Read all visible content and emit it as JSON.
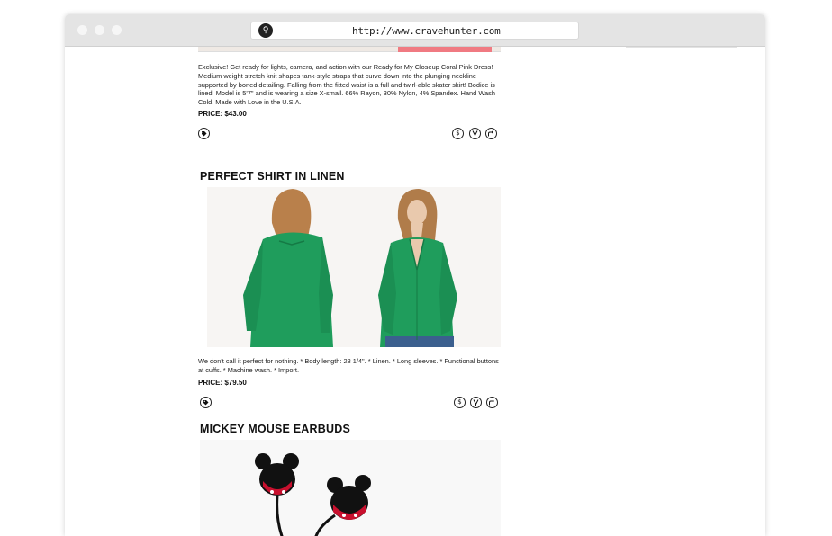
{
  "browser": {
    "url": "http://www.cravehunter.com",
    "logo_glyph": "⚲"
  },
  "products": [
    {
      "description": "Exclusive! Get ready for lights, camera, and action with our Ready for My Closeup Coral Pink Dress! Medium weight stretch knit shapes tank-style straps that curve down into the plunging neckline supported by boned detailing. Falling from the fitted waist is a full and twirl-able skater skirt! Bodice is lined. Model is 5'7\" and is wearing a size X-small. 66% Rayon, 30% Nylon, 4% Spandex. Hand Wash Cold. Made with Love in the U.S.A.",
      "price": "PRICE: $43.00"
    },
    {
      "title": "PERFECT SHIRT IN LINEN",
      "description": "We don't call it perfect for nothing. * Body length: 28 1/4\". * Linen. * Long sleeves. * Functional buttons at cuffs. * Machine wash. * Import.",
      "price": "PRICE: $79.50"
    },
    {
      "title": "MICKEY MOUSE EARBUDS"
    }
  ],
  "icons": {
    "tag": "tag-icon",
    "price": "dollar-icon",
    "crave": "crave-icon",
    "share": "share-icon"
  },
  "colors": {
    "shirt_green": "#1f9d5c",
    "dress_coral": "#f07a82",
    "earbud_red": "#c8102e"
  }
}
